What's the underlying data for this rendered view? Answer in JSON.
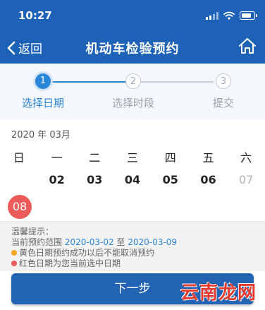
{
  "status_bar": {
    "time": "10:27",
    "icons": [
      "signal-icon",
      "wifi-icon",
      "battery-icon"
    ]
  },
  "nav": {
    "back_label": "返回",
    "title": "机动车检验预约",
    "home_icon": "home-icon"
  },
  "steps": [
    {
      "number": "1",
      "label": "选择日期",
      "state": "active"
    },
    {
      "number": "2",
      "label": "选择时段",
      "state": "idle"
    },
    {
      "number": "3",
      "label": "提交",
      "state": "idle"
    }
  ],
  "calendar": {
    "month": "2020 年 03月",
    "weekdays": [
      "日",
      "一",
      "二",
      "三",
      "四",
      "五",
      "六"
    ],
    "row1": [
      {
        "day": "",
        "state": "empty"
      },
      {
        "day": "02",
        "state": "available"
      },
      {
        "day": "03",
        "state": "available"
      },
      {
        "day": "04",
        "state": "available"
      },
      {
        "day": "05",
        "state": "available"
      },
      {
        "day": "06",
        "state": "available"
      },
      {
        "day": "07",
        "state": "disabled"
      }
    ],
    "selected": "08"
  },
  "tips": {
    "title": "温馨提示：",
    "range_prefix": "当前预约范围",
    "range_start": "2020-03-02",
    "range_to": "至",
    "range_end": "2020-03-09",
    "yellow_note": "黄色日期预约成功以后不能取消预约",
    "red_note": "红色日期为您当前选中日期"
  },
  "next_button": "下一步",
  "watermark": "云南龙网",
  "colors": {
    "header": "#1e62b8",
    "accent": "#2a86d9",
    "selected": "#ec5a5a",
    "yellow_dot": "#f5a623",
    "red_dot": "#ec5a5a",
    "watermark": "#e23a2e"
  }
}
